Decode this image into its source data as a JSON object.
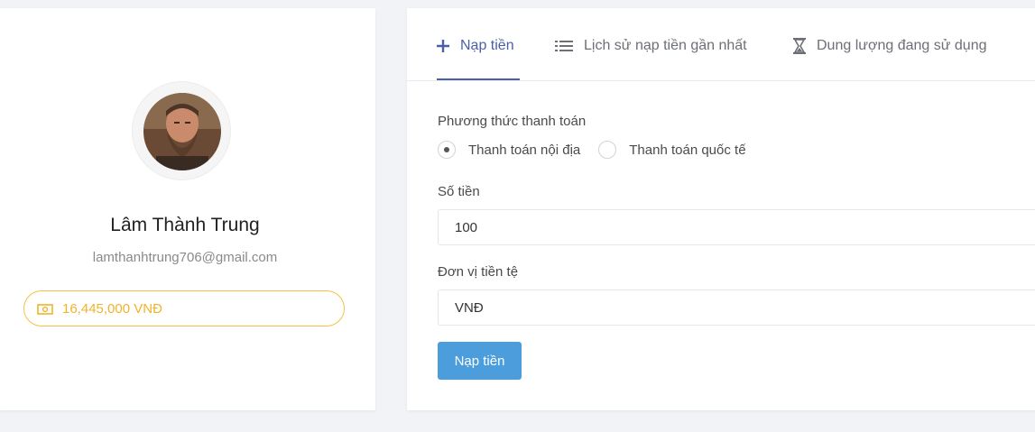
{
  "profile": {
    "name": "Lâm Thành Trung",
    "email": "lamthanhtrung706@gmail.com",
    "balance": "16,445,000 VNĐ",
    "balance_icon": "money-icon",
    "accent_color": "#f4c242"
  },
  "tabs": [
    {
      "label": "Nạp tiền",
      "icon": "plus-icon",
      "active": true
    },
    {
      "label": "Lịch sử nạp tiền gần nhất",
      "icon": "list-icon",
      "active": false
    },
    {
      "label": "Dung lượng đang sử dụng",
      "icon": "hourglass-icon",
      "active": false
    }
  ],
  "form": {
    "payment_method_label": "Phương thức thanh toán",
    "payment_methods": [
      {
        "label": "Thanh toán nội địa",
        "selected": true
      },
      {
        "label": "Thanh toán quốc tế",
        "selected": false
      }
    ],
    "amount_label": "Số tiền",
    "amount_value": "100",
    "currency_label": "Đơn vị tiền tệ",
    "currency_value": "VNĐ",
    "submit_label": "Nạp tiền"
  },
  "colors": {
    "primary": "#4a5fa8",
    "button": "#4c9ddb"
  }
}
